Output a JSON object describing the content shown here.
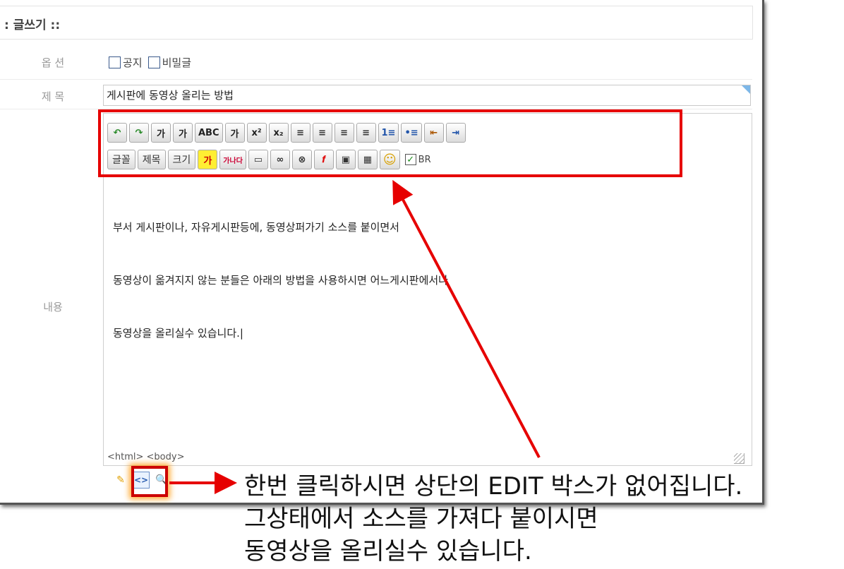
{
  "header": {
    "title": ": 글쓰기 ::"
  },
  "labels": {
    "options": "옵 션",
    "subject": "제 목",
    "content": "내용"
  },
  "options": [
    {
      "label": "공지",
      "checked": false
    },
    {
      "label": "비밀글",
      "checked": false
    }
  ],
  "subject": {
    "value": "게시판에 동영상 올리는 방법"
  },
  "toolbar": {
    "row1": [
      "↶",
      "↷",
      "가",
      "가",
      "ABC",
      "가",
      "x²",
      "x₂",
      "≡",
      "≡",
      "≡",
      "≡",
      "1≡",
      "•≡",
      "⇤",
      "⇥"
    ],
    "row2": [
      "글꼴",
      "제목",
      "크기",
      "가",
      "가나다",
      "▭",
      "∞",
      "⊗",
      "𝒇",
      "▣",
      "▦",
      "☺"
    ],
    "br_label": "BR",
    "br_checked": true
  },
  "editor": {
    "content_lines": [
      "부서 게시판이나, 자유게시판등에, 동영상퍼가기 소스를 붙이면서",
      "동영상이 옮겨지지 않는 분들은 아래의 방법을 사용하시면 어느게시판에서나",
      "동영상을 올리실수 있습니다.|"
    ],
    "status_path": "<html> <body>"
  },
  "mode_bar": {
    "source_label": "<>"
  },
  "callout": {
    "lines": [
      "한번 클릭하시면 상단의 EDIT 박스가 없어집니다.",
      "그상태에서 소스를 가져다 붙이시면",
      "동영상을 올리실수 있습니다."
    ]
  },
  "colors": {
    "annotation": "#e60000",
    "panel_border": "#555555",
    "checkbox": "#3b5a8c"
  }
}
